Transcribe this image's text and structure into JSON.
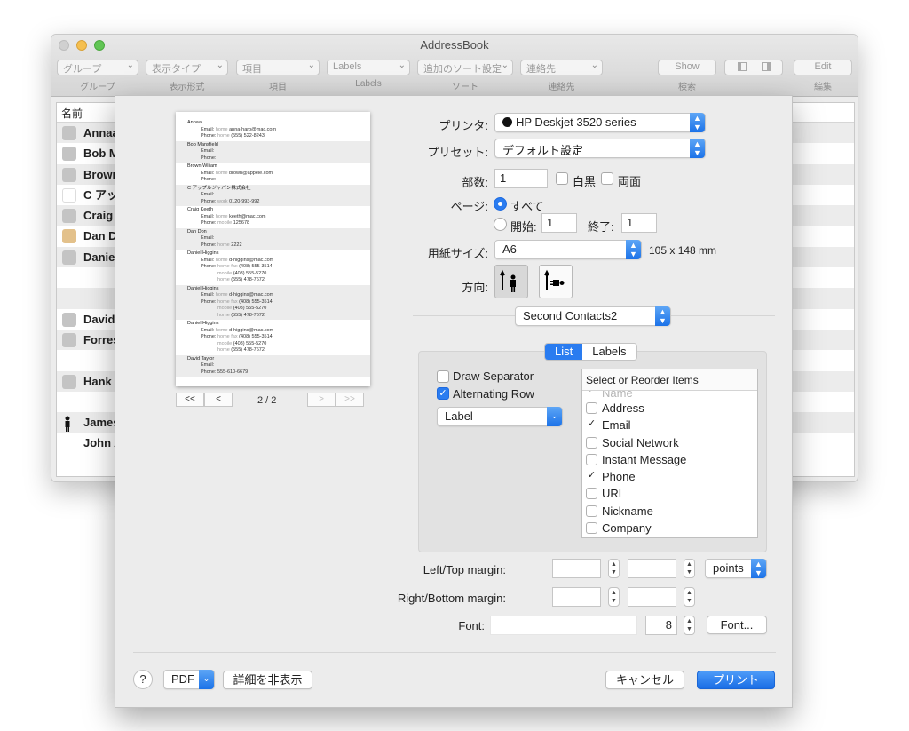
{
  "bg_window": {
    "title": "AddressBook",
    "toolbar": {
      "group_popup": "グループ",
      "display_type_popup": "表示タイプ",
      "item_popup": "項目",
      "labels_popup": "Labels",
      "sort_popup": "追加のソート設定",
      "contact_popup": "連絡先",
      "show_button": "Show",
      "edit_button": "Edit",
      "labels": {
        "group": "グループ",
        "display": "表示形式",
        "item": "項目",
        "labels": "Labels",
        "sort": "ソート",
        "contact": "連絡先",
        "search": "検索",
        "edit": "編集"
      }
    },
    "list_header": "名前",
    "contacts": [
      {
        "name": "Annaa",
        "avatar": "person"
      },
      {
        "name": "Bob M",
        "avatar": "person"
      },
      {
        "name": "Brown",
        "avatar": "person"
      },
      {
        "name": "C アッ",
        "avatar": "apple"
      },
      {
        "name": "Craig",
        "avatar": "person"
      },
      {
        "name": "Dan Do",
        "avatar": "photo"
      },
      {
        "name": "Daniel",
        "avatar": "person"
      },
      {
        "name": "",
        "avatar": ""
      },
      {
        "name": "",
        "avatar": ""
      },
      {
        "name": "David",
        "avatar": "person"
      },
      {
        "name": "Forres",
        "avatar": "person"
      },
      {
        "name": "",
        "avatar": ""
      },
      {
        "name": "Hank",
        "avatar": "person"
      },
      {
        "name": "",
        "avatar": ""
      },
      {
        "name": "James",
        "avatar": "silhouette"
      },
      {
        "name": "John A",
        "avatar": "none"
      }
    ]
  },
  "preview": {
    "entries": [
      {
        "name": "Annaa",
        "lines": [
          {
            "label": "Email:",
            "sub": "home",
            "value": "anna-haro@mac.com"
          },
          {
            "label": "Phone:",
            "sub": "home",
            "value": "(555) 522-8243"
          }
        ]
      },
      {
        "name": "Bob Mansfield",
        "lines": [
          {
            "label": "Email:",
            "sub": "",
            "value": ""
          },
          {
            "label": "Phone:",
            "sub": "",
            "value": ""
          }
        ]
      },
      {
        "name": "Brown Wiliam",
        "lines": [
          {
            "label": "Email:",
            "sub": "home",
            "value": "brown@appele.com"
          },
          {
            "label": "Phone:",
            "sub": "",
            "value": ""
          }
        ]
      },
      {
        "name": "C アップルジャパン株式会社",
        "lines": [
          {
            "label": "Email:",
            "sub": "",
            "value": ""
          },
          {
            "label": "Phone:",
            "sub": "work",
            "value": "0120-993-992"
          }
        ]
      },
      {
        "name": "Craig Keeth",
        "lines": [
          {
            "label": "Email:",
            "sub": "home",
            "value": "keeth@mac.com"
          },
          {
            "label": "Phone:",
            "sub": "mobile",
            "value": "125678"
          }
        ]
      },
      {
        "name": "Dan Don",
        "lines": [
          {
            "label": "Email:",
            "sub": "",
            "value": ""
          },
          {
            "label": "Phone:",
            "sub": "home",
            "value": "2222"
          }
        ]
      },
      {
        "name": "Daniel Higgins",
        "lines": [
          {
            "label": "Email:",
            "sub": "home",
            "value": "d-higgins@mac.com"
          },
          {
            "label": "Phone:",
            "sub": "home fax",
            "value": "(408) 555-3514"
          },
          {
            "label": "",
            "sub": "mobile",
            "value": "(408) 555-5270"
          },
          {
            "label": "",
            "sub": "home",
            "value": "(555) 478-7672"
          }
        ]
      },
      {
        "name": "Daniel Higgins",
        "lines": [
          {
            "label": "Email:",
            "sub": "home",
            "value": "d-higgins@mac.com"
          },
          {
            "label": "Phone:",
            "sub": "home fax",
            "value": "(408) 555-3514"
          },
          {
            "label": "",
            "sub": "mobile",
            "value": "(408) 555-5270"
          },
          {
            "label": "",
            "sub": "home",
            "value": "(555) 478-7672"
          }
        ]
      },
      {
        "name": "Daniel Higgins",
        "lines": [
          {
            "label": "Email:",
            "sub": "home",
            "value": "d-higgins@mac.com"
          },
          {
            "label": "Phone:",
            "sub": "home fax",
            "value": "(408) 555-3514"
          },
          {
            "label": "",
            "sub": "mobile",
            "value": "(408) 555-5270"
          },
          {
            "label": "",
            "sub": "home",
            "value": "(555) 478-7672"
          }
        ]
      },
      {
        "name": "David Taylor",
        "lines": [
          {
            "label": "Email:",
            "sub": "",
            "value": ""
          },
          {
            "label": "Phone:",
            "sub": "",
            "value": "555-610-6679"
          }
        ]
      }
    ],
    "page_indicator": "2 / 2",
    "first_label": "<<",
    "prev_label": "<",
    "next_label": ">",
    "last_label": ">>"
  },
  "print": {
    "printer_label": "プリンタ:",
    "printer_value": "HP Deskjet 3520 series",
    "preset_label": "プリセット:",
    "preset_value": "デフォルト設定",
    "copies_label": "部数:",
    "copies_value": "1",
    "bw_label": "白黒",
    "duplex_label": "両面",
    "pages_label": "ページ:",
    "all_label": "すべて",
    "from_label": "開始:",
    "from_value": "1",
    "to_label": "終了:",
    "to_value": "1",
    "paper_label": "用紙サイズ:",
    "paper_value": "A6",
    "paper_dims": "105 x 148 mm",
    "orientation_label": "方向:",
    "section_popup": "Second Contacts2"
  },
  "contacts_panel": {
    "tab_list": "List",
    "tab_labels": "Labels",
    "draw_separator": "Draw Separator",
    "alternating_row": "Alternating Row",
    "label_popup": "Label",
    "items_header": "Select or Reorder Items",
    "items": [
      {
        "label": "Name",
        "checked": true,
        "faded": true
      },
      {
        "label": "Address",
        "checked": false
      },
      {
        "label": "Email",
        "checked": true
      },
      {
        "label": "Social Network",
        "checked": false
      },
      {
        "label": "Instant Message",
        "checked": false
      },
      {
        "label": "Phone",
        "checked": true
      },
      {
        "label": "URL",
        "checked": false
      },
      {
        "label": "Nickname",
        "checked": false
      },
      {
        "label": "Company",
        "checked": false
      }
    ],
    "left_top_margin_label": "Left/Top margin:",
    "right_bottom_margin_label": "Right/Bottom margin:",
    "units_popup": "points",
    "font_label": "Font:",
    "font_value": "",
    "font_size": "8",
    "font_button": "Font..."
  },
  "footer": {
    "help": "?",
    "pdf": "PDF",
    "hide_details": "詳細を非表示",
    "cancel": "キャンセル",
    "print": "プリント"
  },
  "colors": {
    "accent": "#2a7cf0"
  }
}
